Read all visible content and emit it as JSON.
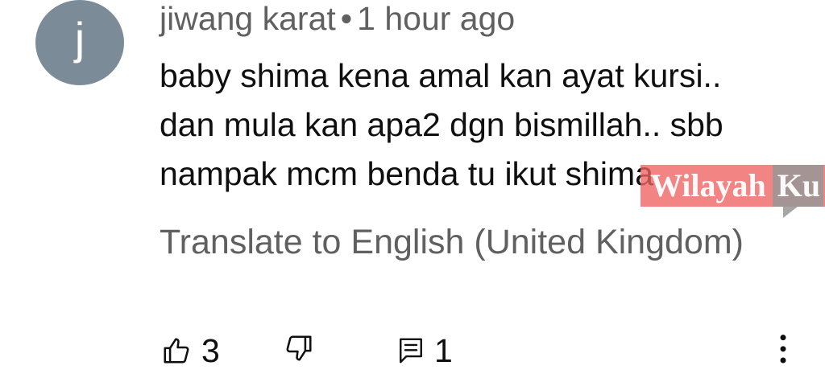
{
  "comment": {
    "avatar_letter": "j",
    "avatar_color": "#7b8c98",
    "author": "jiwang karat",
    "separator": "•",
    "time": "1 hour ago",
    "lines": [
      "baby shima kena amal kan ayat kursi..",
      "dan mula kan apa2 dgn bismillah.. sbb",
      "nampak mcm benda tu ikut shima"
    ],
    "translate_label": "Translate to English (United Kingdom)",
    "like_count": "3",
    "reply_count": "1"
  },
  "watermark": {
    "text_main": "Wilayah",
    "text_tail": "Ku"
  },
  "icons": {
    "like": "thumbs-up-icon",
    "dislike": "thumbs-down-icon",
    "reply": "comment-icon",
    "more": "more-vertical-icon"
  }
}
